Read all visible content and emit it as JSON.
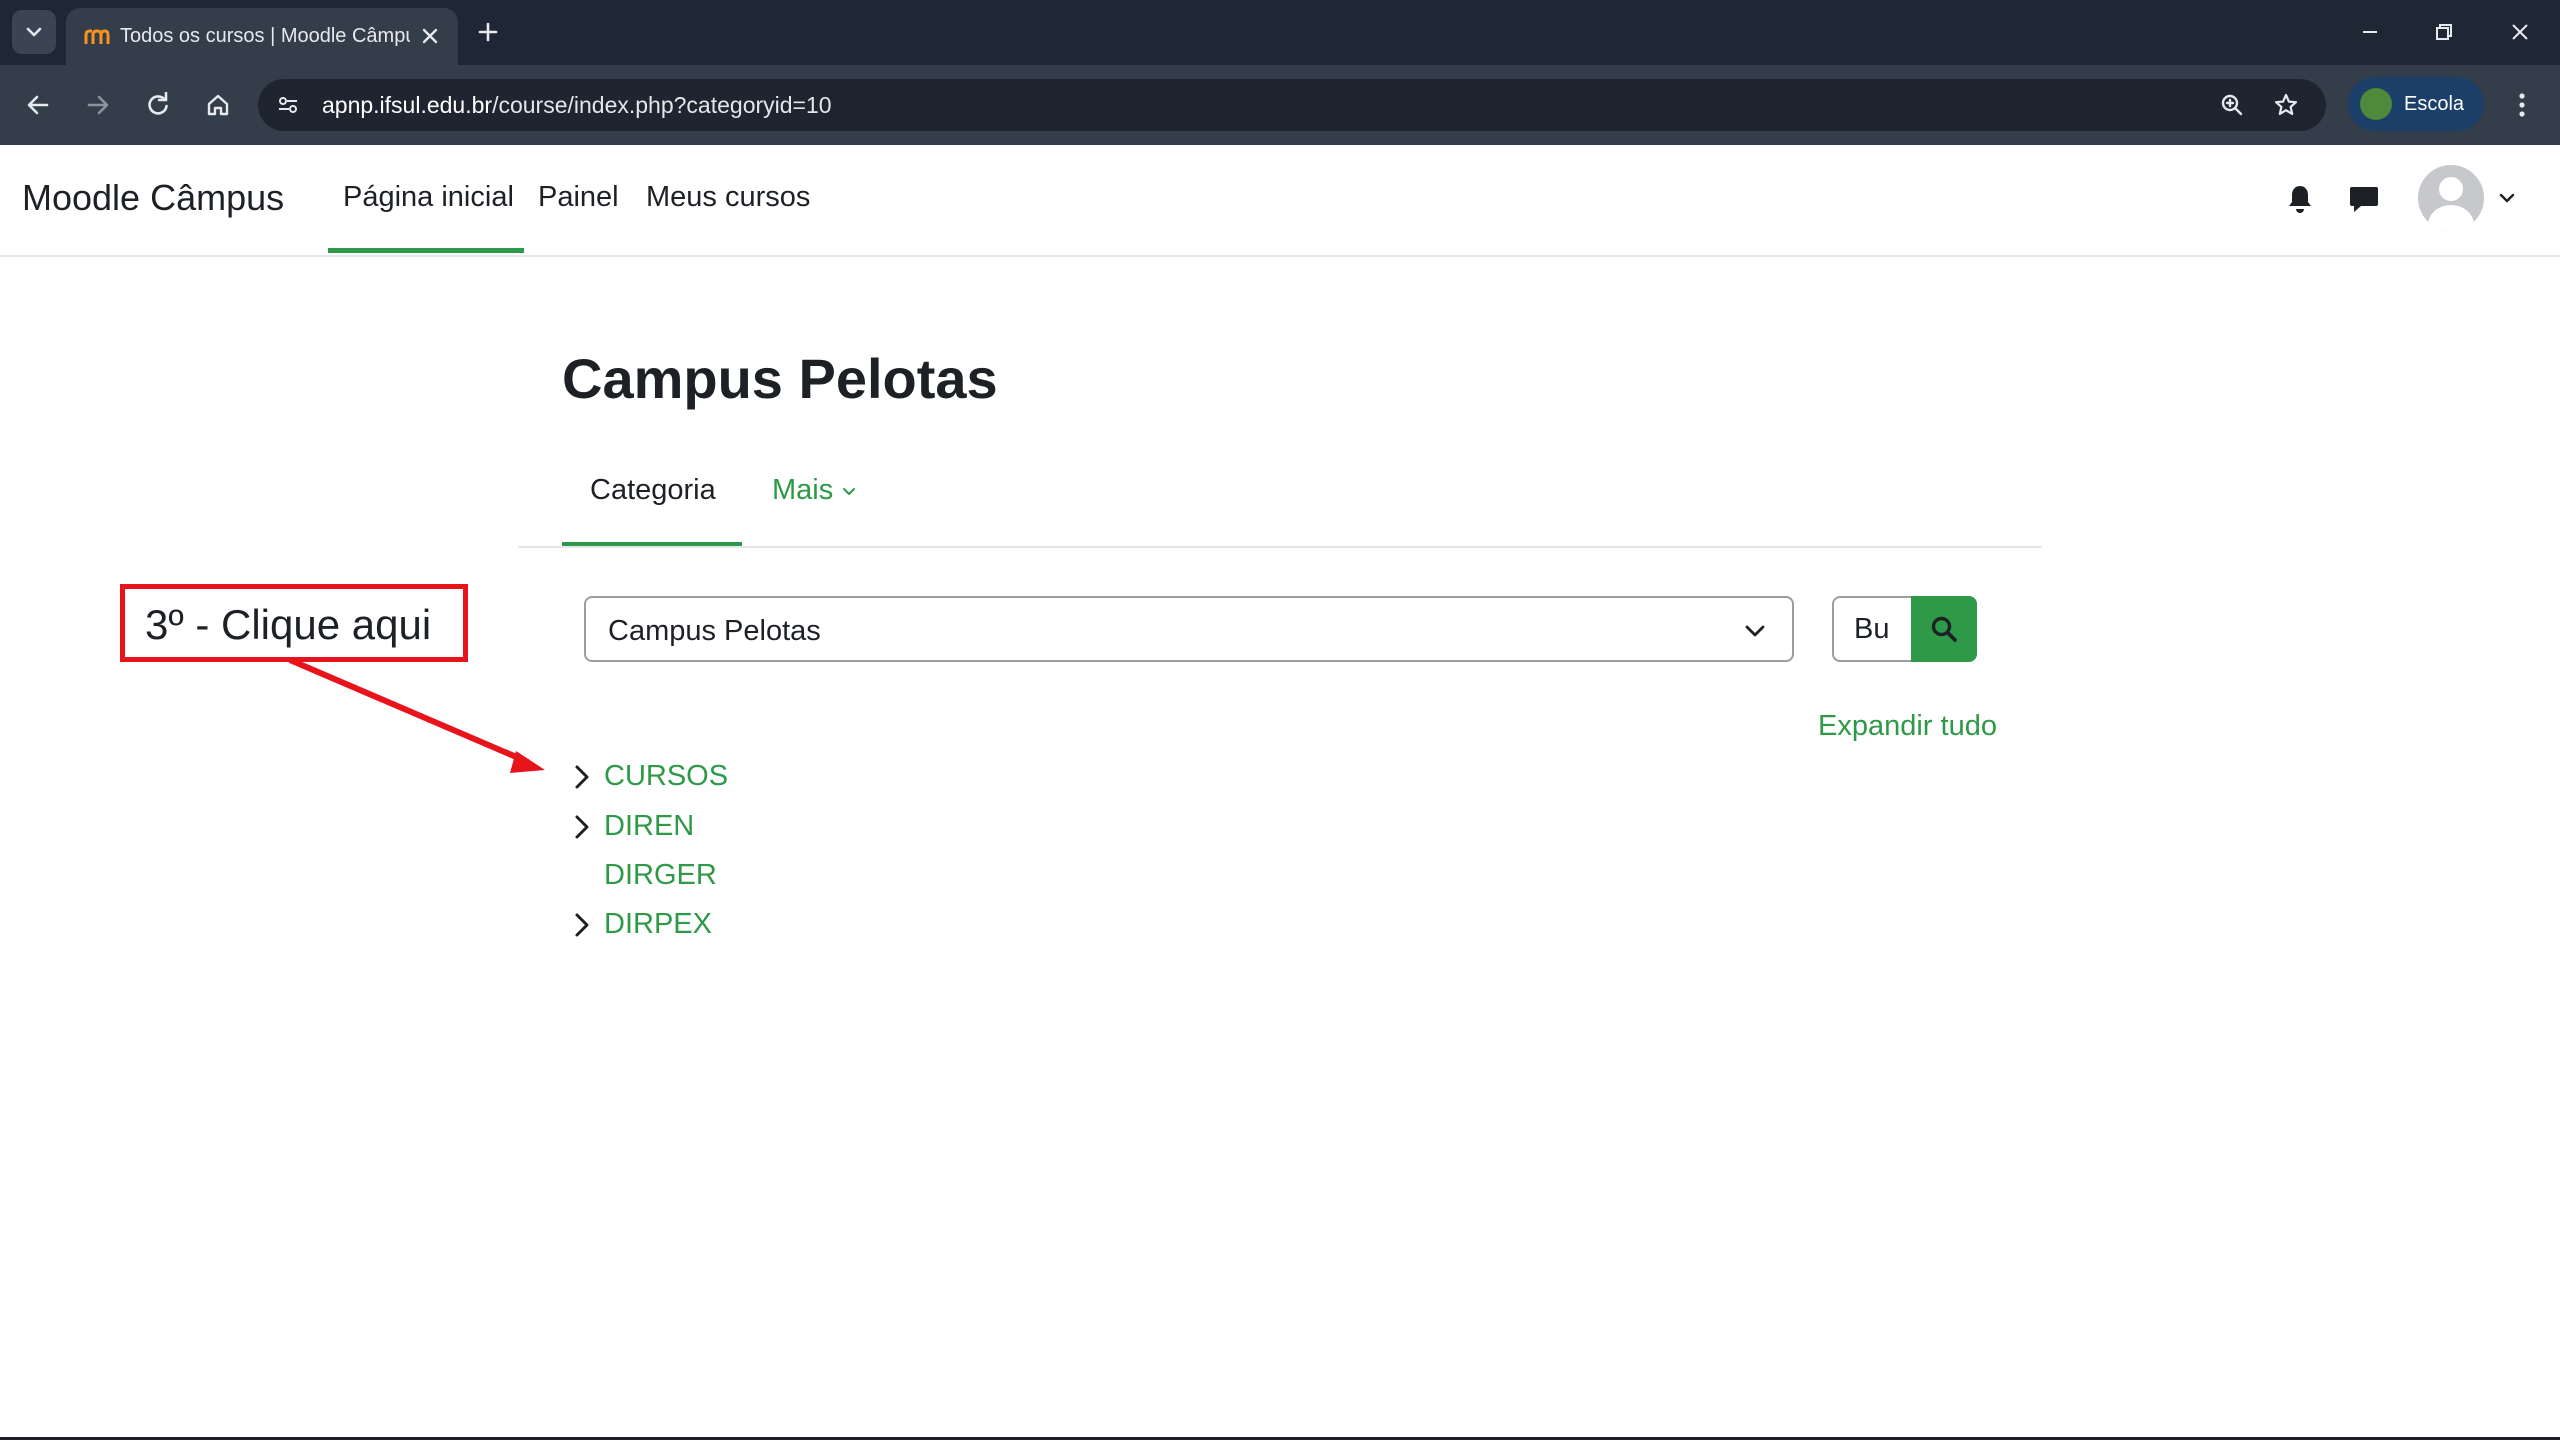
{
  "browser": {
    "tab_title": "Todos os cursos | Moodle Câmpus",
    "url_host": "apnp.ifsul.edu.br",
    "url_path": "/course/index.php?categoryid=10",
    "profile_label": "Escola"
  },
  "navbar": {
    "brand": "Moodle Câmpus",
    "links": [
      {
        "label": "Página inicial",
        "active": true
      },
      {
        "label": "Painel",
        "active": false
      },
      {
        "label": "Meus cursos",
        "active": false
      }
    ]
  },
  "page": {
    "title": "Campus Pelotas",
    "secondary_tabs": [
      {
        "label": "Categoria",
        "active": true
      },
      {
        "label": "Mais",
        "active": false
      }
    ],
    "category_select_value": "Campus Pelotas",
    "search_value": "Bu",
    "expand_all_label": "Expandir tudo",
    "categories": [
      {
        "label": "CURSOS",
        "expandable": true
      },
      {
        "label": "DIREN",
        "expandable": true
      },
      {
        "label": "DIRGER",
        "expandable": false
      },
      {
        "label": "DIRPEX",
        "expandable": true
      }
    ]
  },
  "annotation": {
    "text": "3º - Clique aqui"
  },
  "colors": {
    "accent_green": "#2e9a47",
    "annotation_red": "#e8141c",
    "chrome_dark": "#1e2733",
    "chrome_toolbar": "#343d4a"
  },
  "icons": {
    "tab_search": "chevron-down-icon",
    "favicon": "moodle-icon",
    "tab_close": "close-icon",
    "new_tab": "plus-icon",
    "back": "arrow-left-icon",
    "forward": "arrow-right-icon",
    "reload": "reload-icon",
    "home": "home-icon",
    "site_info": "tune-icon",
    "zoom": "zoom-icon",
    "bookmark": "star-icon",
    "menu": "kebab-icon",
    "notifications": "bell-icon",
    "messages": "chat-icon",
    "search": "search-icon"
  }
}
